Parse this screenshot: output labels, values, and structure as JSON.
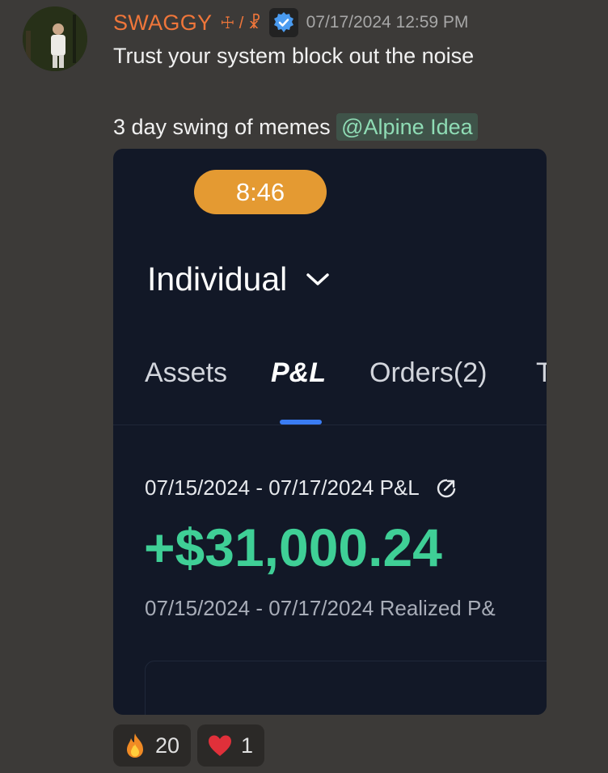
{
  "message": {
    "author": "SWAGGY",
    "role_tags": "☩ / ☧",
    "timestamp": "07/17/2024 12:59 PM",
    "line1": "Trust your system block out the noise",
    "line2_text": "3 day swing of memes",
    "mention": "@Alpine Idea"
  },
  "attachment": {
    "status_time": "8:46",
    "account_name": "Individual",
    "tabs": [
      "Assets",
      "P&L",
      "Orders(2)",
      "T"
    ],
    "active_tab": "P&L",
    "range_label": "07/15/2024 - 07/17/2024 P&L",
    "pnl_value": "+$31,000.24",
    "realized_label": "07/15/2024 - 07/17/2024 Realized P&",
    "colors": {
      "pnl": "#3fcf96",
      "tab_indicator": "#3a7cf3",
      "time_pill": "#e49a32"
    }
  },
  "reactions": [
    {
      "icon": "fire-icon",
      "count": "20"
    },
    {
      "icon": "heart-icon",
      "count": "1"
    }
  ],
  "colors": {
    "username": "#f0763a",
    "mention_bg": "#3f5349",
    "mention_text": "#8fdcb5"
  }
}
